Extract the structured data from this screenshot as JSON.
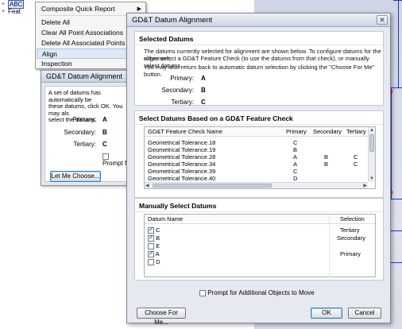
{
  "tree": {
    "items": [
      {
        "toggle": "+",
        "label": "ABC"
      },
      {
        "toggle": "+",
        "label": "Feat"
      }
    ]
  },
  "context_menu": {
    "items": [
      {
        "label": "Composite Quick Report",
        "submenu": true
      },
      {
        "label": "Delete All"
      },
      {
        "label": "Clear All Point Associations"
      },
      {
        "label": "Delete All Associated Points"
      },
      {
        "label": "Align",
        "highlighted": true
      },
      {
        "label": "Inspection"
      }
    ]
  },
  "small_dialog": {
    "title": "GD&T Datum Alignment",
    "description": "A set of datums has automatically be\nthese datums, click OK.  You may als\nselect the datums.",
    "primary_label": "Primary:",
    "primary_value": "A",
    "secondary_label": "Secondary:",
    "secondary_value": "B",
    "tertiary_label": "Tertiary:",
    "tertiary_value": "C",
    "prompt_label": "Prompt f",
    "let_me_choose": "Let Me Choose..."
  },
  "main_dialog": {
    "title": "GD&T Datum Alignment",
    "close_glyph": "✕",
    "selected": {
      "heading": "Selected Datums",
      "line1": "The datums currently selected for alignment are shown below.  To configure datums for the alignment,",
      "line2": "either select a GD&T Feature Check (to use the datums from that check), or manually select datums.",
      "line3": "You may also return back to automatic datum selection by clicking the \"Choose For Me\" button.",
      "primary_label": "Primary:",
      "primary_value": "A",
      "secondary_label": "Secondary:",
      "secondary_value": "B",
      "tertiary_label": "Tertiary:",
      "tertiary_value": "C"
    },
    "feature_check": {
      "heading": "Select Datums Based on a GD&T Feature Check",
      "columns": [
        "GD&T Feature Check Name",
        "Primary",
        "Secondary",
        "Tertiary"
      ],
      "rows": [
        {
          "name": "Geometrical Tolerance.18",
          "primary": "C",
          "secondary": "",
          "tertiary": ""
        },
        {
          "name": "Geometrical Tolerance.19",
          "primary": "B",
          "secondary": "",
          "tertiary": ""
        },
        {
          "name": "Geometrical Tolerance.28",
          "primary": "A",
          "secondary": "B",
          "tertiary": "C"
        },
        {
          "name": "Geometrical Tolerance.34",
          "primary": "A",
          "secondary": "B",
          "tertiary": "C"
        },
        {
          "name": "Geometrical Tolerance.39",
          "primary": "C",
          "secondary": "",
          "tertiary": ""
        },
        {
          "name": "Geometrical Tolerance.40",
          "primary": "D",
          "secondary": "",
          "tertiary": ""
        }
      ]
    },
    "manual": {
      "heading": "Manually Select Datums",
      "columns": [
        "Datum Name",
        "Selection"
      ],
      "rows": [
        {
          "name": "C",
          "checked": true,
          "selection": "Tertiary"
        },
        {
          "name": "B",
          "checked": true,
          "selection": "Secondary"
        },
        {
          "name": "E",
          "checked": false,
          "selection": ""
        },
        {
          "name": "A",
          "checked": true,
          "selection": "Primary"
        },
        {
          "name": "D",
          "checked": false,
          "selection": ""
        }
      ]
    },
    "prompt_label": "Prompt for Additional Objects to Move",
    "choose_for_me": "Choose For Me...",
    "ok": "OK",
    "cancel": "Cancel"
  },
  "colors": {
    "viewport_line": "#2230d0",
    "viewport_mark": "#e01010",
    "menu_highlight": "#dfe9f7"
  }
}
